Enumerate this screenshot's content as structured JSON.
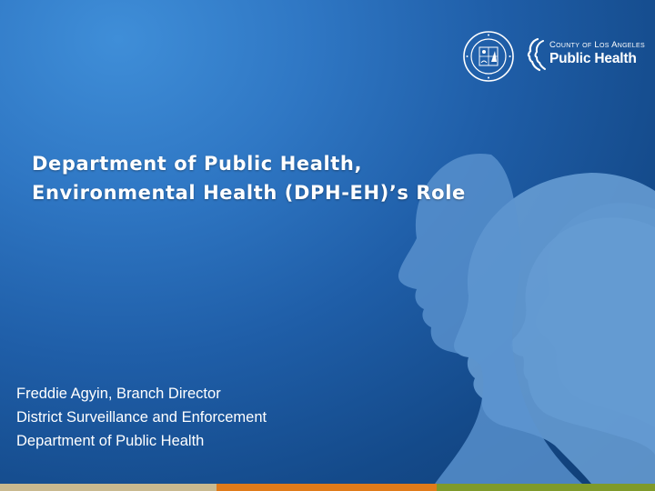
{
  "slide": {
    "title_lines": [
      "Department of Public Health,",
      "Environmental Health (DPH-EH)’s Role"
    ],
    "presenter_lines": [
      "Freddie Agyin, Branch Director",
      "District Surveillance and Enforcement",
      "Department of Public Health"
    ]
  },
  "logo": {
    "line1": "County of Los Angeles",
    "line2": "Public Health",
    "seal_icon": "county-seal-icon",
    "brand_icon": "public-health-mark-icon"
  },
  "colors": {
    "background_dark": "#0f3c72",
    "background_light": "#3f8ed8",
    "silhouette": "#5a92cc",
    "bar_tan": "#c9b98f",
    "bar_orange": "#e07b1a",
    "bar_green": "#7f9a2a"
  }
}
